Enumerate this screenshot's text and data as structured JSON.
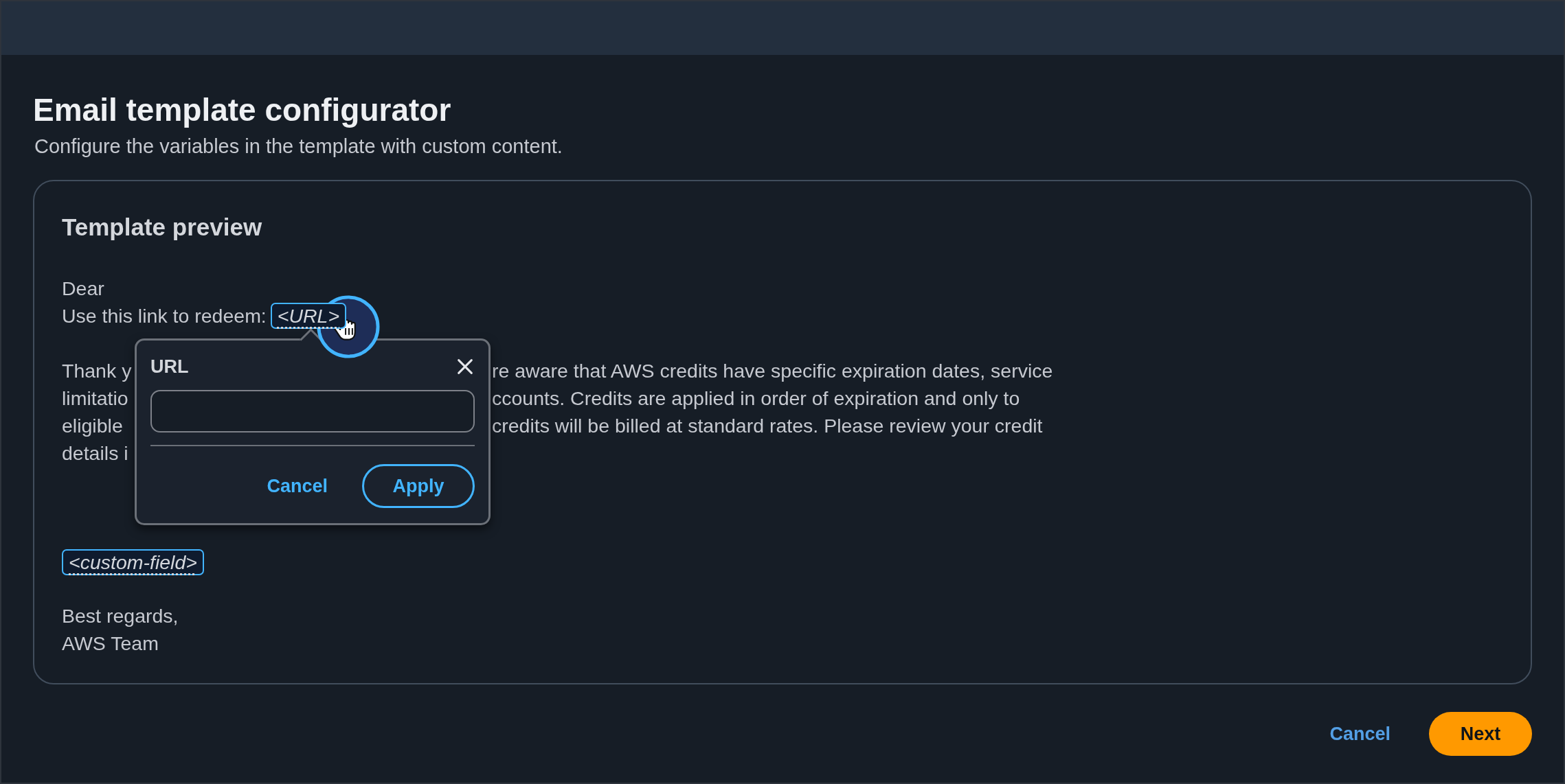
{
  "page": {
    "title": "Email template configurator",
    "description": "Configure the variables in the template with custom content."
  },
  "preview": {
    "title": "Template preview",
    "greeting": "Dear",
    "link_line": {
      "label": "Use this link to redeem:",
      "variable": "<URL>"
    },
    "paragraph_lines": [
      {
        "left": "Thank y",
        "right": "re aware that AWS credits have specific expiration dates, service"
      },
      {
        "left": "limitatio",
        "right": "ccounts. Credits are applied in order of expiration and only to"
      },
      {
        "left": "eligible",
        "right": "credits will be billed at standard rates. Please review your credit"
      },
      {
        "left": "details i"
      }
    ],
    "custom_variable": "<custom-field>",
    "closing": [
      "Best regards,",
      "AWS Team"
    ]
  },
  "popover": {
    "title": "URL",
    "buttons": [
      {
        "label": "Cancel",
        "kind": "link"
      },
      {
        "label": "Apply",
        "kind": "outline"
      }
    ]
  },
  "footer_buttons": [
    {
      "label": "Cancel",
      "kind": "link"
    },
    {
      "label": "Next",
      "kind": "primary"
    }
  ]
}
